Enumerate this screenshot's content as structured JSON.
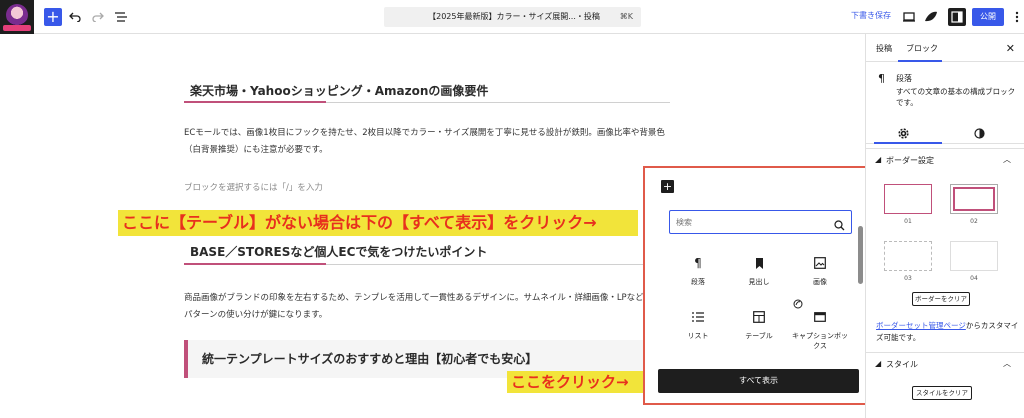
{
  "toolbar": {
    "doc_title": "【2025年最新版】カラー・サイズ展開...・投稿",
    "shortcut": "⌘K",
    "save_draft": "下書き保存",
    "publish": "公開"
  },
  "editor": {
    "heading1": "楽天市場・Yahooショッピング・Amazonの画像要件",
    "para1": "ECモールでは、画像1枚目にフックを持たせ、2枚目以降でカラー・サイズ展開を丁寧に見せる設計が鉄則。画像比率や背景色（白背景推奨）にも注意が必要です。",
    "placeholder": "ブロックを選択するには「/」を入力",
    "heading2": "BASE／STORESなど個人ECで気をつけたいポイント",
    "para2": "商品画像がブランドの印象を左右するため、テンプレを活用して一貫性あるデザインに。サムネイル・詳細画像・LPなど複数パターンの使い分けが鍵になります。",
    "heading3": "統一テンプレートサイズのおすすめと理由【初心者でも安心】"
  },
  "annotations": {
    "callout1": "ここに【テーブル】がない場合は下の【すべて表示】をクリック→",
    "callout2": "ここをクリック→"
  },
  "inserter": {
    "search_placeholder": "検索",
    "blocks": [
      {
        "label": "段落",
        "icon": "paragraph-icon"
      },
      {
        "label": "見出し",
        "icon": "bookmark-icon"
      },
      {
        "label": "画像",
        "icon": "image-icon"
      },
      {
        "label": "リスト",
        "icon": "list-icon"
      },
      {
        "label": "テーブル",
        "icon": "table-icon"
      },
      {
        "label": "キャプションボックス",
        "icon": "caption-box-icon"
      }
    ],
    "show_all": "すべて表示"
  },
  "sidebar": {
    "tab_post": "投稿",
    "tab_block": "ブロック",
    "block_name": "段落",
    "block_desc": "すべての文章の基本の構成ブロックです。",
    "border_panel": "ボーダー設定",
    "presets": [
      "01",
      "02",
      "03",
      "04"
    ],
    "clear_border": "ボーダーをクリア",
    "note_link": "ボーダーセット管理ページ",
    "note_rest": "からカスタマイズ可能です。",
    "style_panel": "スタイル",
    "clear_style": "スタイルをクリア"
  },
  "colors": {
    "accent": "#3858e9",
    "heading_accent": "#c0507a",
    "callout_bg": "#f2e43a",
    "callout_text": "#e8301e",
    "highlight_border": "#e05a4a"
  }
}
